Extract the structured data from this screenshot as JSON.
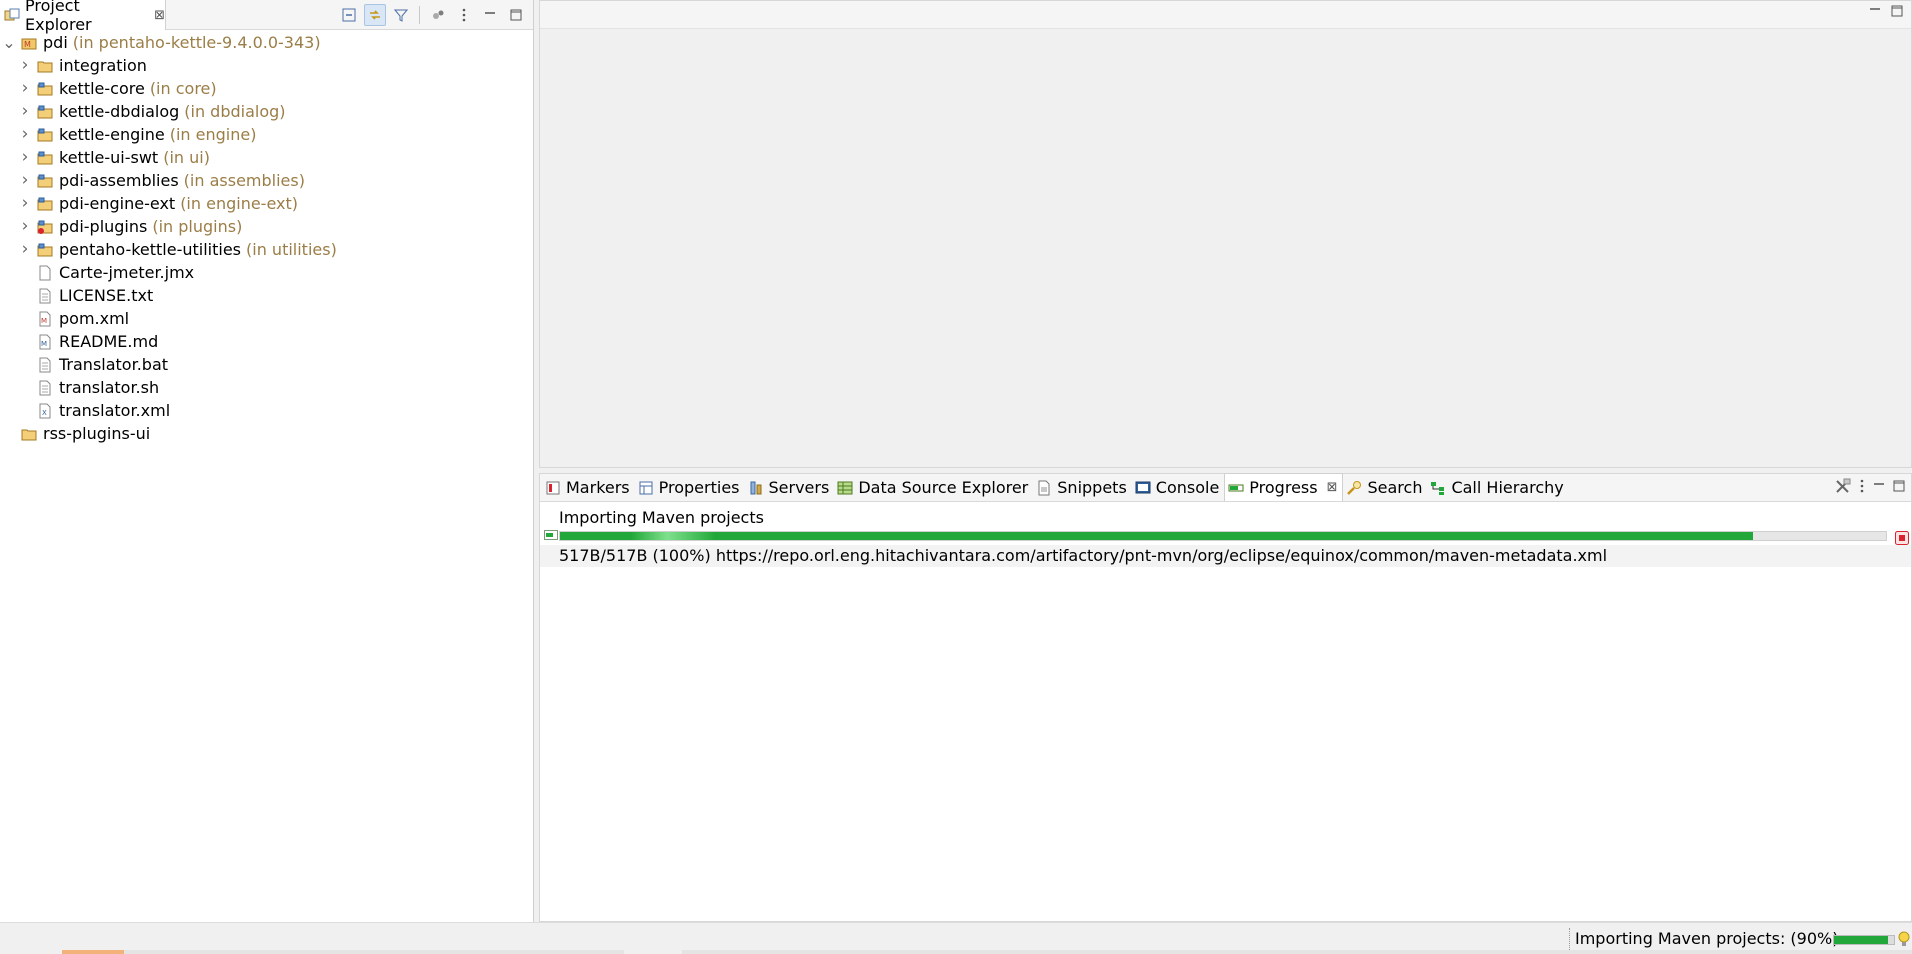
{
  "explorer": {
    "title": "Project Explorer",
    "close": "⊠",
    "toolbar": [
      {
        "name": "collapse-all-icon",
        "active": false
      },
      {
        "name": "link-with-editor-icon",
        "active": true
      },
      {
        "name": "filter-icon",
        "active": false
      },
      {
        "name": "focus-icon",
        "active": false
      },
      {
        "name": "view-menu-icon",
        "active": false
      }
    ],
    "tree": [
      {
        "label": "pdi",
        "decor": "(in pentaho-kettle-9.4.0.0-343)",
        "level": 0,
        "expander": "open",
        "icon": "maven-project-icon"
      },
      {
        "label": "integration",
        "decor": "",
        "level": 1,
        "expander": "closed",
        "icon": "folder-icon"
      },
      {
        "label": "kettle-core",
        "decor": "(in core)",
        "level": 1,
        "expander": "closed",
        "icon": "module-folder-icon"
      },
      {
        "label": "kettle-dbdialog",
        "decor": "(in dbdialog)",
        "level": 1,
        "expander": "closed",
        "icon": "module-folder-icon"
      },
      {
        "label": "kettle-engine",
        "decor": "(in engine)",
        "level": 1,
        "expander": "closed",
        "icon": "module-folder-icon"
      },
      {
        "label": "kettle-ui-swt",
        "decor": "(in ui)",
        "level": 1,
        "expander": "closed",
        "icon": "module-folder-icon"
      },
      {
        "label": "pdi-assemblies",
        "decor": "(in assemblies)",
        "level": 1,
        "expander": "closed",
        "icon": "module-folder-icon"
      },
      {
        "label": "pdi-engine-ext",
        "decor": "(in engine-ext)",
        "level": 1,
        "expander": "closed",
        "icon": "module-folder-icon"
      },
      {
        "label": "pdi-plugins",
        "decor": "(in plugins)",
        "level": 1,
        "expander": "closed",
        "icon": "module-folder-error-icon"
      },
      {
        "label": "pentaho-kettle-utilities",
        "decor": "(in utilities)",
        "level": 1,
        "expander": "closed",
        "icon": "module-folder-icon"
      },
      {
        "label": "Carte-jmeter.jmx",
        "decor": "",
        "level": 1,
        "expander": "none",
        "icon": "file-icon"
      },
      {
        "label": "LICENSE.txt",
        "decor": "",
        "level": 1,
        "expander": "none",
        "icon": "text-file-icon"
      },
      {
        "label": "pom.xml",
        "decor": "",
        "level": 1,
        "expander": "none",
        "icon": "pom-file-icon"
      },
      {
        "label": "README.md",
        "decor": "",
        "level": 1,
        "expander": "none",
        "icon": "markdown-file-icon"
      },
      {
        "label": "Translator.bat",
        "decor": "",
        "level": 1,
        "expander": "none",
        "icon": "text-file-icon"
      },
      {
        "label": "translator.sh",
        "decor": "",
        "level": 1,
        "expander": "none",
        "icon": "text-file-icon"
      },
      {
        "label": "translator.xml",
        "decor": "",
        "level": 1,
        "expander": "none",
        "icon": "xml-file-icon"
      },
      {
        "label": "rss-plugins-ui",
        "decor": "",
        "level": 0,
        "expander": "none",
        "icon": "project-icon"
      }
    ]
  },
  "bottom": {
    "tabs": [
      {
        "label": "Markers",
        "icon": "markers-icon",
        "selected": false
      },
      {
        "label": "Properties",
        "icon": "properties-icon",
        "selected": false
      },
      {
        "label": "Servers",
        "icon": "servers-icon",
        "selected": false
      },
      {
        "label": "Data Source Explorer",
        "icon": "data-source-icon",
        "selected": false
      },
      {
        "label": "Snippets",
        "icon": "snippets-icon",
        "selected": false
      },
      {
        "label": "Console",
        "icon": "console-icon",
        "selected": false
      },
      {
        "label": "Progress",
        "icon": "progress-icon",
        "selected": true
      },
      {
        "label": "Search",
        "icon": "search-icon",
        "selected": false
      },
      {
        "label": "Call Hierarchy",
        "icon": "call-hierarchy-icon",
        "selected": false
      }
    ],
    "progress": {
      "job_name": "Importing Maven projects",
      "percent": 0.9,
      "detail": "517B/517B (100%) https://repo.orl.eng.hitachivantara.com/artifactory/pnt-mvn/org/eclipse/equinox/common/maven-metadata.xml"
    }
  },
  "statusbar": {
    "text": "Importing Maven projects: (90%)",
    "percent": 0.9
  },
  "colors": {
    "accent_green": "#22a83a",
    "decoration": "#9b7e47",
    "stop_red": "#d9232e"
  }
}
